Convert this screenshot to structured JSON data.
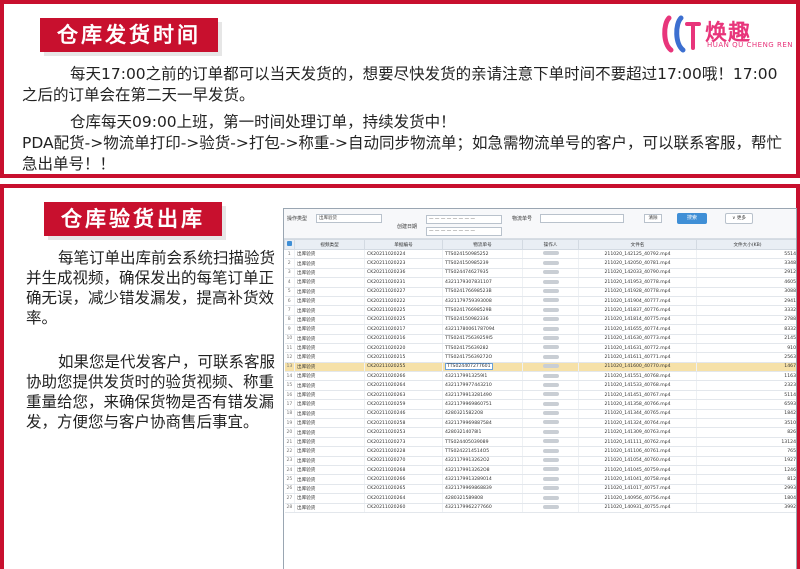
{
  "top": {
    "title": "仓库发货时间",
    "para1": "每天17:00之前的订单都可以当天发货的，想要尽快发货的亲请注意下单时间不要超过17:00哦！17:00之后的订单会在第二天一早发货。",
    "para2_line1": "仓库每天09:00上班，第一时间处理订单，持续发货中！",
    "para2_line2": "PDA配货->物流单打印->验货->打包->称重->自动同步物流单；如急需物流单号的客户，可以联系客服，帮忙急出单号！！"
  },
  "logo": {
    "name": "焕趣",
    "sub": "HUAN QU CHENG REN",
    "color": "#e8357b"
  },
  "bottom": {
    "title": "仓库验货出库",
    "text1": "每笔订单出库前会系统扫描验货并生成视频，确保发出的每笔订单正确无误，减少错发漏发，提高补货效率。",
    "text2": "如果您是代发客户，可联系客服协助您提供发货时的验货视频、称重重量给您，来确保货物是否有错发漏发，方便您与客户协商售后事宜。"
  },
  "shot": {
    "filter": {
      "op_type_label": "操作类型",
      "op_type_value": "出库验货",
      "date_label": "创建日期",
      "date_from": "— — — — — — — —",
      "date_to": "— — — — — — — —",
      "logistics_label": "物流单号",
      "reset": "清除",
      "search": "搜索",
      "more": "∨ 更多"
    },
    "columns": [
      "",
      "视频类型",
      "单据编号",
      "物流单号",
      "操作人",
      "文件名",
      "文件大小(KB)"
    ],
    "rows": [
      {
        "type": "出库验货",
        "doc": "CK20211020224",
        "track": "TTS024150985252",
        "file": "211020_142125_40792.mp4",
        "size": "5514"
      },
      {
        "type": "出库验货",
        "doc": "CK20211020223",
        "track": "TTS024150985239",
        "file": "211020_142050_40781.mp4",
        "size": "3348"
      },
      {
        "type": "出库验货",
        "doc": "CK20211020236",
        "track": "TTS024474627935",
        "file": "211020_142033_40790.mp4",
        "size": "2912"
      },
      {
        "type": "出库验货",
        "doc": "CK20211020231",
        "track": "4321179307831107",
        "file": "211020_141953_40778.mp4",
        "size": "4605"
      },
      {
        "type": "出库验货",
        "doc": "CK20211020227",
        "track": "TTS024176698523B",
        "file": "211020_141928_40778.mp4",
        "size": "3088"
      },
      {
        "type": "出库验货",
        "doc": "CK20211020222",
        "track": "4321179759393008",
        "file": "211020_141904_40777.mp4",
        "size": "2941"
      },
      {
        "type": "出库验货",
        "doc": "CK20211020225",
        "track": "TTS024176698529B",
        "file": "211020_141837_40776.mp4",
        "size": "3332"
      },
      {
        "type": "出库验货",
        "doc": "CK20211020225",
        "track": "TTS024150982336",
        "file": "211020_141814_40775.mp4",
        "size": "2788"
      },
      {
        "type": "出库验货",
        "doc": "CK20211020217",
        "track": "43211780061787094",
        "file": "211020_141655_40774.mp4",
        "size": "8332"
      },
      {
        "type": "出库验货",
        "doc": "CK20211020216",
        "track": "TTS024175639259I5",
        "file": "211020_141630_40773.mp4",
        "size": "2145"
      },
      {
        "type": "出库验货",
        "doc": "CK20211020220",
        "track": "TTS024175639282",
        "file": "211020_141631_40772.mp4",
        "size": "910"
      },
      {
        "type": "出库验货",
        "doc": "CK20211020215",
        "track": "TTS024175639272O",
        "file": "211020_141611_40771.mp4",
        "size": "2563"
      },
      {
        "type": "出库验货",
        "doc": "CK20211020255",
        "track": "TTS024407277601",
        "file": "211020_141600_40770.mp4",
        "size": "1467",
        "hl": true
      },
      {
        "type": "出库验货",
        "doc": "CK20211020266",
        "track": "4321179913259I1",
        "file": "211020_141551_40768.mp4",
        "size": "1163"
      },
      {
        "type": "出库验货",
        "doc": "CK20211020264",
        "track": "4321179977443210",
        "file": "211020_141533_40768.mp4",
        "size": "2323"
      },
      {
        "type": "出库验货",
        "doc": "CK20211020263",
        "track": "4321179913281490",
        "file": "211020_141451_40767.mp4",
        "size": "5114"
      },
      {
        "type": "出库验货",
        "doc": "CK20211020259",
        "track": "4321179969860751",
        "file": "211020_141358_40766.mp4",
        "size": "6593"
      },
      {
        "type": "出库验货",
        "doc": "CK20211020246",
        "track": "4280321582208",
        "file": "211020_141344_40765.mp4",
        "size": "1842"
      },
      {
        "type": "出库验货",
        "doc": "CK20211020258",
        "track": "4321179969887584",
        "file": "211020_141324_40764.mp4",
        "size": "3510"
      },
      {
        "type": "出库验货",
        "doc": "CK20211020253",
        "track": "42803214078I1",
        "file": "211020_141309_40763.mp4",
        "size": "826"
      },
      {
        "type": "出库验货",
        "doc": "CK20211020273",
        "track": "TTS024405039089",
        "file": "211020_141111_40762.mp4",
        "size": "13124"
      },
      {
        "type": "出库验货",
        "doc": "CK20211020228",
        "track": "TTS0242214514O5",
        "file": "211020_141106_40761.mp4",
        "size": "765"
      },
      {
        "type": "出库验货",
        "doc": "CK20211020270",
        "track": "4321179913262O2",
        "file": "211020_141054_40760.mp4",
        "size": "1927"
      },
      {
        "type": "出库验货",
        "doc": "CK20211020268",
        "track": "4321179913262O8",
        "file": "211020_141045_40759.mp4",
        "size": "1246"
      },
      {
        "type": "出库验货",
        "doc": "CK20211020266",
        "track": "4321179913289014",
        "file": "211020_141041_40758.mp4",
        "size": "812"
      },
      {
        "type": "出库验货",
        "doc": "CK20211020265",
        "track": "4321179969868839",
        "file": "211020_141017_40757.mp4",
        "size": "2993"
      },
      {
        "type": "出库验货",
        "doc": "CK20211020264",
        "track": "4280321589808",
        "file": "211020_140956_40756.mp4",
        "size": "1804"
      },
      {
        "type": "出库验货",
        "doc": "CK20211020260",
        "track": "4321179962277660",
        "file": "211020_140931_40755.mp4",
        "size": "3992"
      }
    ]
  }
}
